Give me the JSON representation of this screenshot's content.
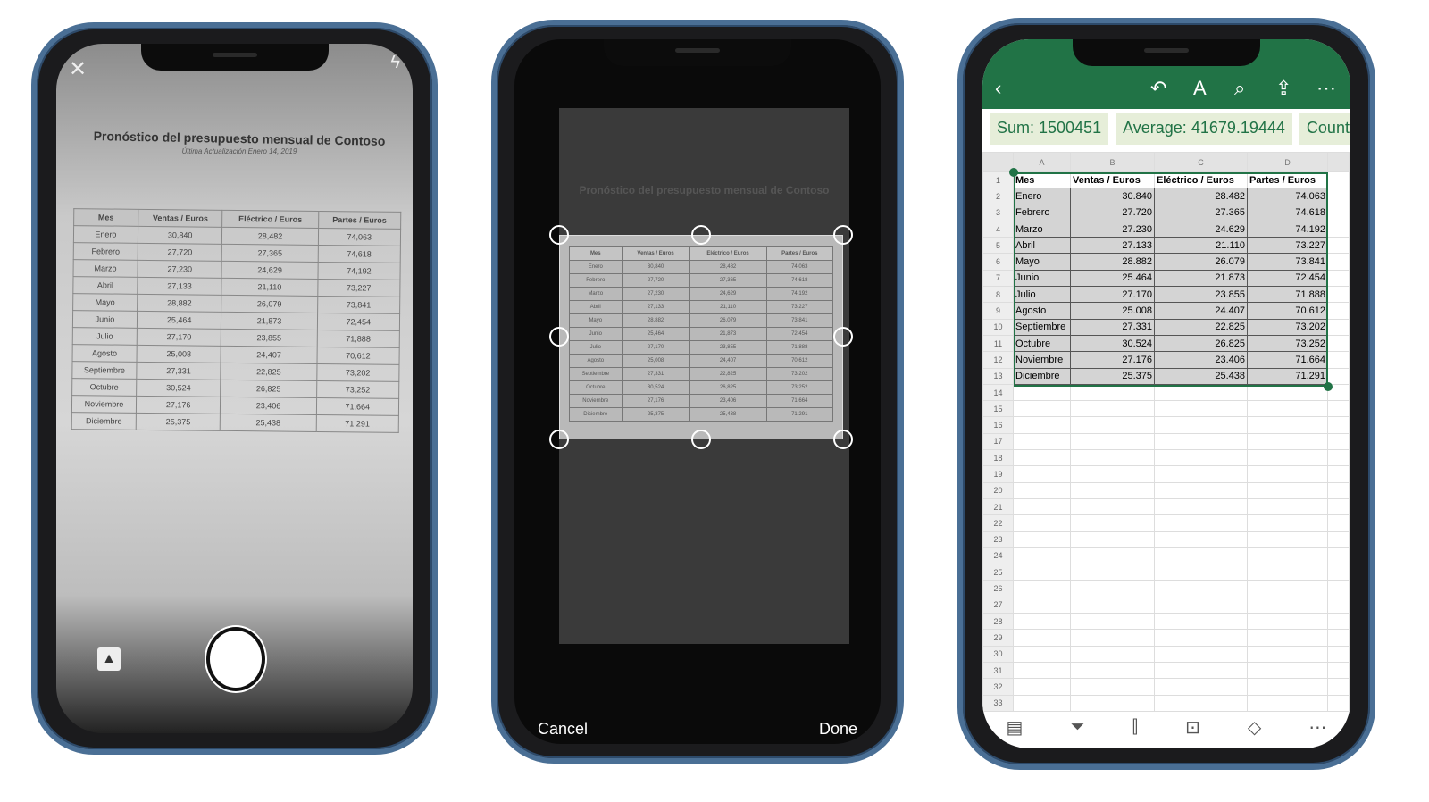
{
  "document": {
    "title": "Pronóstico del  presupuesto mensual de Contoso",
    "subtitle": "Última Actualización Enero 14, 2019",
    "headers": [
      "Mes",
      "Ventas / Euros",
      "Eléctrico / Euros",
      "Partes / Euros"
    ],
    "rows": [
      [
        "Enero",
        "30,840",
        "28,482",
        "74,063"
      ],
      [
        "Febrero",
        "27,720",
        "27,365",
        "74,618"
      ],
      [
        "Marzo",
        "27,230",
        "24,629",
        "74,192"
      ],
      [
        "Abril",
        "27,133",
        "21,110",
        "73,227"
      ],
      [
        "Mayo",
        "28,882",
        "26,079",
        "73,841"
      ],
      [
        "Junio",
        "25,464",
        "21,873",
        "72,454"
      ],
      [
        "Julio",
        "27,170",
        "23,855",
        "71,888"
      ],
      [
        "Agosto",
        "25,008",
        "24,407",
        "70,612"
      ],
      [
        "Septiembre",
        "27,331",
        "22,825",
        "73,202"
      ],
      [
        "Octubre",
        "30,524",
        "26,825",
        "73,252"
      ],
      [
        "Noviembre",
        "27,176",
        "23,406",
        "71,664"
      ],
      [
        "Diciembre",
        "25,375",
        "25,438",
        "71,291"
      ]
    ]
  },
  "camera": {
    "close_icon": "close-icon",
    "flash_icon": "flash-auto-icon",
    "gallery_icon": "image-icon"
  },
  "crop": {
    "cancel": "Cancel",
    "done": "Done"
  },
  "excel": {
    "accent": "#217346",
    "sum": "Sum: 1500451",
    "average": "Average: 41679.19444",
    "count": "Count",
    "columns": [
      "A",
      "B",
      "C",
      "D"
    ],
    "headers": [
      "Mes",
      "Ventas / Euros",
      "Eléctrico / Euros",
      "Partes / Euros"
    ],
    "rows": [
      [
        "Enero",
        "30.840",
        "28.482",
        "74.063"
      ],
      [
        "Febrero",
        "27.720",
        "27.365",
        "74.618"
      ],
      [
        "Marzo",
        "27.230",
        "24.629",
        "74.192"
      ],
      [
        "Abril",
        "27.133",
        "21.110",
        "73.227"
      ],
      [
        "Mayo",
        "28.882",
        "26.079",
        "73.841"
      ],
      [
        "Junio",
        "25.464",
        "21.873",
        "72.454"
      ],
      [
        "Julio",
        "27.170",
        "23.855",
        "71.888"
      ],
      [
        "Agosto",
        "25.008",
        "24.407",
        "70.612"
      ],
      [
        "Septiembre",
        "27.331",
        "22.825",
        "73.202"
      ],
      [
        "Octubre",
        "30.524",
        "26.825",
        "73.252"
      ],
      [
        "Noviembre",
        "27.176",
        "23.406",
        "71.664"
      ],
      [
        "Diciembre",
        "25.375",
        "25.438",
        "71.291"
      ]
    ],
    "row_count": 33
  }
}
